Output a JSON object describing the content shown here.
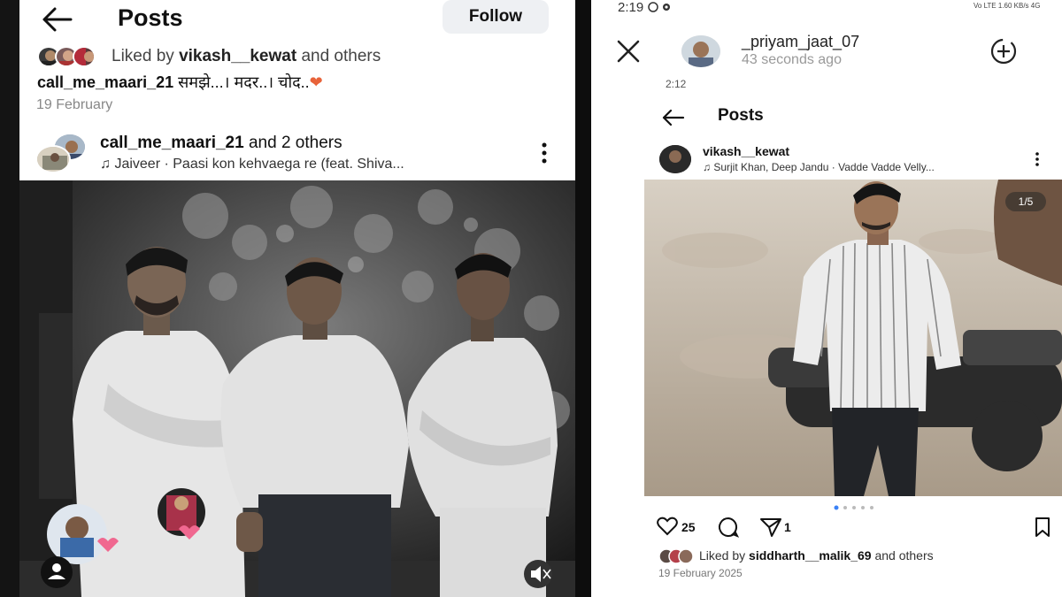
{
  "left": {
    "header": {
      "title": "Posts",
      "follow_label": "Follow"
    },
    "liked": {
      "prefix": "Liked by",
      "user": "vikash__kewat",
      "suffix": "and others"
    },
    "caption": {
      "user": "call_me_maari_21",
      "text": "समझे...। मदर..। चोद..",
      "emoji": "❤"
    },
    "date": "19 February",
    "post": {
      "user": "call_me_maari_21",
      "user_suffix": "and 2 others",
      "music_note": "♫",
      "music": "Jaiveer · Paasi kon kehvaega re (feat. Shiva..."
    }
  },
  "right": {
    "status": {
      "time": "2:19",
      "icons": "Vo LTE 1.60 KB/s 4G"
    },
    "story": {
      "user": "_priyam_jaat_07",
      "ago": "43 seconds ago"
    },
    "screenshot": {
      "status_time": "2:12",
      "title": "Posts",
      "post_user": "vikash__kewat",
      "music_note": "♫",
      "music": "Surjit Khan, Deep Jandu · Vadde Vadde Velly...",
      "counter": "1/5",
      "likes": "25",
      "shares": "1",
      "liked": {
        "prefix": "Liked by",
        "user": "siddharth__malik_69",
        "suffix": "and others"
      },
      "date": "19 February 2025"
    }
  },
  "icons": [
    "back-arrow-icon",
    "more-vertical-icon",
    "music-note-icon",
    "close-icon",
    "add-circle-icon",
    "heart-icon",
    "comment-icon",
    "share-icon",
    "bookmark-icon",
    "mute-icon",
    "user-tag-icon"
  ],
  "colors": {
    "heart_emoji": "#e8633a",
    "follow_bg": "#eef0f3",
    "date_grey": "#888888"
  }
}
